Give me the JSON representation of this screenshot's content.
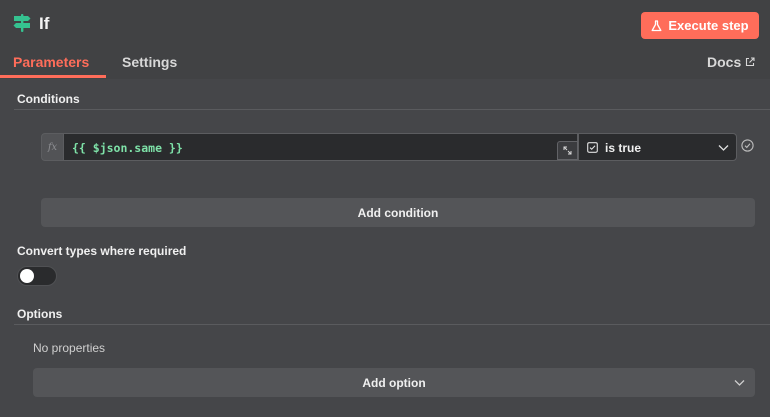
{
  "node": {
    "title": "If",
    "icon": "signpost-icon"
  },
  "header": {
    "execute_label": "Execute step",
    "execute_icon": "flask-icon"
  },
  "tabs": [
    {
      "label": "Parameters",
      "active": true
    },
    {
      "label": "Settings",
      "active": false
    }
  ],
  "docs": {
    "label": "Docs",
    "icon": "external-link-icon"
  },
  "conditions": {
    "title": "Conditions",
    "items": [
      {
        "fx": "fx",
        "expression": "{{ $json.same }}",
        "operator": "is true",
        "operator_icon": "checkbox-icon"
      }
    ],
    "add_label": "Add condition"
  },
  "convert_types": {
    "label": "Convert types where required",
    "enabled": false
  },
  "options": {
    "title": "Options",
    "empty_text": "No properties",
    "add_label": "Add option"
  },
  "colors": {
    "accent": "#ff6d5a",
    "expression_text": "#7ee2a8",
    "background": "#414244"
  }
}
